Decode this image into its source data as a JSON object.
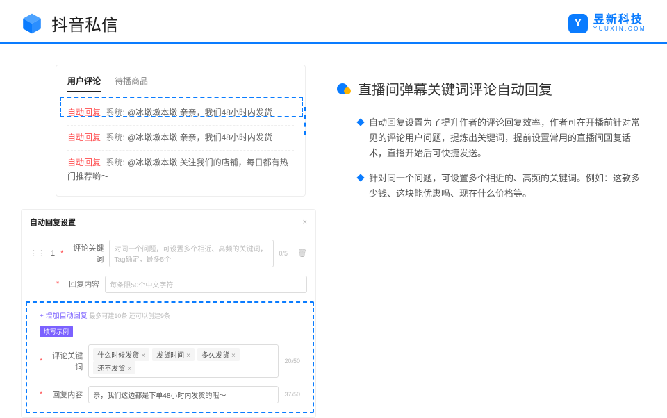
{
  "header": {
    "title": "抖音私信",
    "brand_name": "昱新科技",
    "brand_sub": "YUUXIN.COM"
  },
  "card_top": {
    "tab1": "用户评论",
    "tab2": "待播商品",
    "auto_tag": "自动回复",
    "sys": "系统:",
    "c1": "@冰墩墩本墩 亲亲，我们48小时内发货",
    "c2": "@冰墩墩本墩 亲亲，我们48小时内发货",
    "c3": "@冰墩墩本墩 关注我们的店铺，每日都有热门推荐哟～"
  },
  "settings": {
    "title": "自动回复设置",
    "row_num": "1",
    "kw_label": "评论关键词",
    "kw_placeholder": "对同一个问题，可设置多个相近、高频的关键词，Tag确定，最多5个",
    "kw_count": "0/5",
    "content_label": "回复内容",
    "content_placeholder": "每条限50个中文字符",
    "add_link": "+ 增加自动回复",
    "add_hint": "最多可建10条 还可以创建9条",
    "example_tag": "填写示例",
    "ex_kw_label": "评论关键词",
    "ex_tags": [
      "什么时候发货",
      "发货时间",
      "多久发货",
      "还不发货"
    ],
    "ex_kw_count": "20/50",
    "ex_content_label": "回复内容",
    "ex_content": "亲，我们这边都是下单48小时内发货的哦～",
    "ex_content_count": "37/50"
  },
  "right": {
    "title": "直播间弹幕关键词评论自动回复",
    "b1": "自动回复设置为了提升作者的评论回复效率，作者可在开播前针对常见的评论用户问题，提炼出关键词，提前设置常用的直播间回复话术，直播开始后可快捷发送。",
    "b2": "针对同一个问题，可设置多个相近的、高频的关键词。例如：这款多少钱、这块能优惠吗、现在什么价格等。"
  }
}
